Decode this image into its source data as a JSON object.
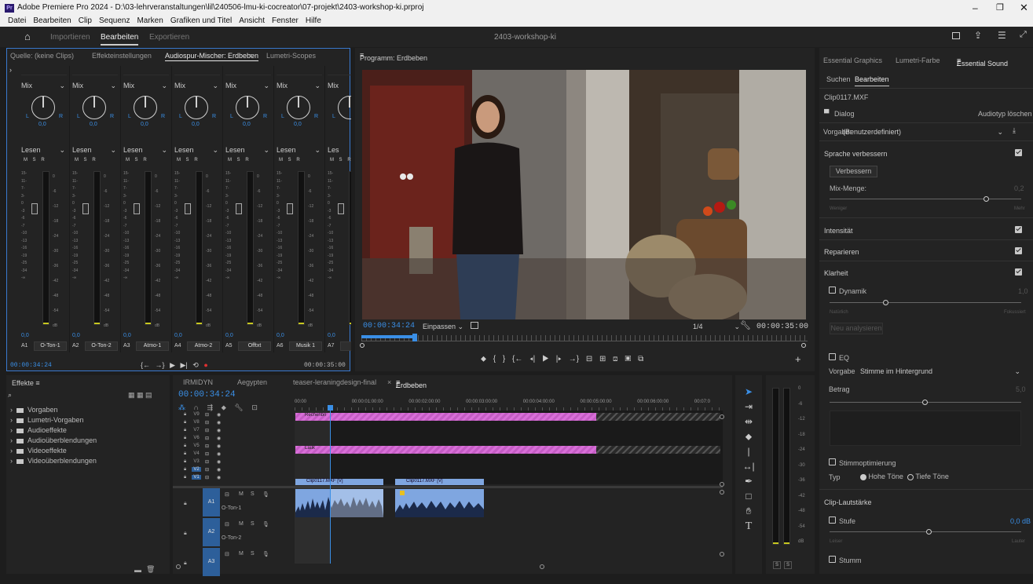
{
  "window": {
    "app_icon": "Pr",
    "title": "Adobe Premiere Pro 2024 - D:\\03-lehrveranstaltungen\\lil\\240506-lmu-ki-cocreator\\07-projekt\\2403-workshop-ki.prproj"
  },
  "menu": [
    "Datei",
    "Bearbeiten",
    "Clip",
    "Sequenz",
    "Marken",
    "Grafiken und Titel",
    "Ansicht",
    "Fenster",
    "Hilfe"
  ],
  "appbar": {
    "tabs": [
      "Importieren",
      "Bearbeiten",
      "Exportieren"
    ],
    "active": "Bearbeiten",
    "project_name": "2403-workshop-ki"
  },
  "source_panel": {
    "tabs": [
      "Quelle: (keine Clips)",
      "Effekteinstellungen",
      "Audiospur-Mischer: Erdbeben",
      "Lumetri-Scopes"
    ],
    "active": "Audiospur-Mischer: Erdbeben",
    "mixer": {
      "strips": [
        {
          "mode": "Mix",
          "pan": "0,0",
          "read": "Lesen",
          "track": "A1",
          "name": "O-Ton-1",
          "level": "0,0"
        },
        {
          "mode": "Mix",
          "pan": "0,0",
          "read": "Lesen",
          "track": "A2",
          "name": "O-Ton-2",
          "level": "0,0"
        },
        {
          "mode": "Mix",
          "pan": "0,0",
          "read": "Lesen",
          "track": "A3",
          "name": "Atmo-1",
          "level": "0,0"
        },
        {
          "mode": "Mix",
          "pan": "0,0",
          "read": "Lesen",
          "track": "A4",
          "name": "Atmo-2",
          "level": "0,0"
        },
        {
          "mode": "Mix",
          "pan": "0,0",
          "read": "Lesen",
          "track": "A5",
          "name": "Offtxt",
          "level": "0,0"
        },
        {
          "mode": "Mix",
          "pan": "0,0",
          "read": "Lesen",
          "track": "A6",
          "name": "Musik 1",
          "level": "0,0"
        },
        {
          "mode": "Mix",
          "pan": "",
          "read": "Les",
          "track": "A7",
          "name": "",
          "level": "0,0"
        }
      ],
      "msr": [
        "M",
        "S",
        "R"
      ],
      "scale_left": [
        "15-",
        "11-",
        "7-",
        "3-",
        "0",
        "-3",
        "-6",
        "-7",
        "-10",
        "-13",
        "-16",
        "-19",
        "-25",
        "-34",
        "-∞"
      ],
      "scale_right": [
        "0",
        "-6",
        "-12",
        "-18",
        "-24",
        "-30",
        "-36",
        "-42",
        "-48",
        "-54",
        "dB"
      ],
      "time_current": "00:00:34:24",
      "time_end": "00:00:35:00"
    }
  },
  "program_panel": {
    "title": "Programm: Erdbeben",
    "timecode": "00:00:34:24",
    "fit": "Einpassen",
    "resolution": "1/4",
    "duration": "00:00:35:00",
    "progress_fraction": 0.12
  },
  "essential_panel": {
    "tabs": [
      "Essential Graphics",
      "Lumetri-Farbe",
      "Essential Sound"
    ],
    "active": "Essential Sound",
    "subtabs": [
      "Suchen",
      "Bearbeiten"
    ],
    "active_subtab": "Bearbeiten",
    "clip": "Clip0117.MXF",
    "type": "Dialog",
    "clear_type": "Audiotyp löschen",
    "preset_label": "Vorgabe:",
    "preset_value": "(Benutzerdefiniert)",
    "speech": {
      "label": "Sprache verbessern",
      "button": "Verbessern",
      "mix_label": "Mix-Menge:",
      "mix_value": "0,2",
      "min_label": "Weniger",
      "max_label": "Mehr"
    },
    "sections": [
      "Intensität",
      "Reparieren",
      "Klarheit"
    ],
    "dynamics": {
      "label": "Dynamik",
      "value": "1,0",
      "min_label": "Natürlich",
      "max_label": "Fokussiert",
      "reanalyze": "Neu analysieren"
    },
    "eq": {
      "label": "EQ",
      "preset_label": "Vorgabe",
      "preset_value": "Stimme im Hintergrund",
      "amount_label": "Betrag",
      "amount_value": "5,0"
    },
    "voice": {
      "label": "Stimmoptimierung",
      "type_label": "Typ",
      "high": "Hohe Töne",
      "low": "Tiefe Töne"
    },
    "clip_volume": {
      "label": "Clip-Lautstärke",
      "level_label": "Stufe",
      "level_value": "0,0 dB",
      "min_label": "Leiser",
      "max_label": "Lauter",
      "mute_label": "Stumm"
    }
  },
  "effects_panel": {
    "title": "Effekte",
    "items": [
      "Vorgaben",
      "Lumetri-Vorgaben",
      "Audioeffekte",
      "Audioüberblendungen",
      "Videoeffekte",
      "Videoüberblendungen"
    ]
  },
  "timeline": {
    "tabs": [
      "IRMIDYN",
      "Aegypten",
      "teaser-leraningdesign-final",
      "Erdbeben"
    ],
    "active": "Erdbeben",
    "timecode": "00:00:34:24",
    "ruler": [
      "00:00",
      "00:00:01:00:00",
      "00:00:02:00:00",
      "00:00:03:00:00",
      "00:00:04:00:00",
      "00:00:05:00:00",
      "00:00:06:00:00",
      "00:07:0"
    ],
    "video_tracks": [
      "V9",
      "V8",
      "V7",
      "V6",
      "V5",
      "V4",
      "V3",
      "V2",
      "V1"
    ],
    "audio_tracks": [
      {
        "id": "A1",
        "name": "O-Ton-1"
      },
      {
        "id": "A2",
        "name": "O-Ton-2"
      },
      {
        "id": "A3",
        "name": ""
      }
    ],
    "track_buttons": [
      "M",
      "S"
    ],
    "clips": {
      "pink1": "Rechenbn",
      "pink2": "Lauk",
      "video1": "Clip0117.MXF [V]",
      "video2": "Clip0117.MXF [V]"
    }
  },
  "right_meter": {
    "scale": [
      "0",
      "-6",
      "-12",
      "-18",
      "-24",
      "-30",
      "-36",
      "-42",
      "-48",
      "-54",
      "dB"
    ],
    "solo": [
      "S",
      "S"
    ]
  },
  "colors": {
    "accent": "#3a8fe6",
    "pink_clip": "#d86fd8",
    "blue_clip": "#7fa6e0",
    "panel_bg": "#232323",
    "record": "#e03030"
  }
}
